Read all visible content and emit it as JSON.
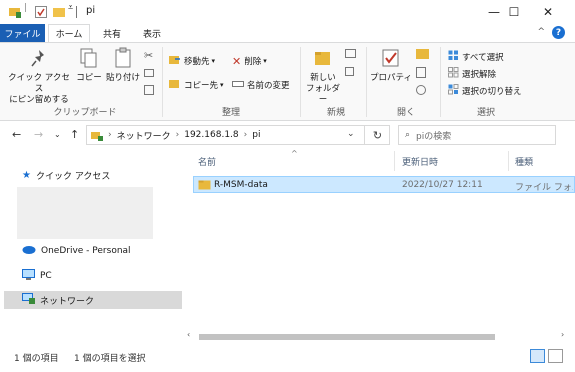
{
  "window": {
    "title": "pi",
    "minimize": "—",
    "maximize": "☐",
    "close": "✕"
  },
  "tabs": {
    "file": "ファイル",
    "home": "ホーム",
    "share": "共有",
    "view": "表示",
    "help": "?"
  },
  "ribbon": {
    "clipboard": {
      "group_label": "クリップボード",
      "pin_quick_access": "クイック アクセス\nにピン留めする",
      "copy": "コピー",
      "paste": "貼り付け"
    },
    "organize": {
      "group_label": "整理",
      "move_to": "移動先",
      "copy_to": "コピー先",
      "delete": "削除",
      "rename": "名前の変更"
    },
    "new": {
      "group_label": "新規",
      "new_folder": "新しい\nフォルダー"
    },
    "open": {
      "group_label": "開く",
      "properties": "プロパティ"
    },
    "select": {
      "group_label": "選択",
      "select_all": "すべて選択",
      "select_none": "選択解除",
      "invert_selection": "選択の切り替え"
    }
  },
  "address": {
    "breadcrumb": [
      "ネットワーク",
      "192.168.1.8",
      "pi"
    ],
    "search_placeholder": "piの検索"
  },
  "nav_pane": {
    "quick_access": "クイック アクセス",
    "onedrive": "OneDrive - Personal",
    "pc": "PC",
    "network": "ネットワーク"
  },
  "columns": {
    "name": "名前",
    "modified": "更新日時",
    "type": "種類"
  },
  "files": [
    {
      "name": "R-MSM-data",
      "modified": "2022/10/27 12:11",
      "type": "ファイル フォルダー"
    }
  ],
  "status": {
    "item_count": "1 個の項目",
    "selected_count": "1 個の項目を選択"
  },
  "colors": {
    "accent": "#1a5fb4",
    "selection": "#cce8ff",
    "folder": "#e8b83c"
  }
}
